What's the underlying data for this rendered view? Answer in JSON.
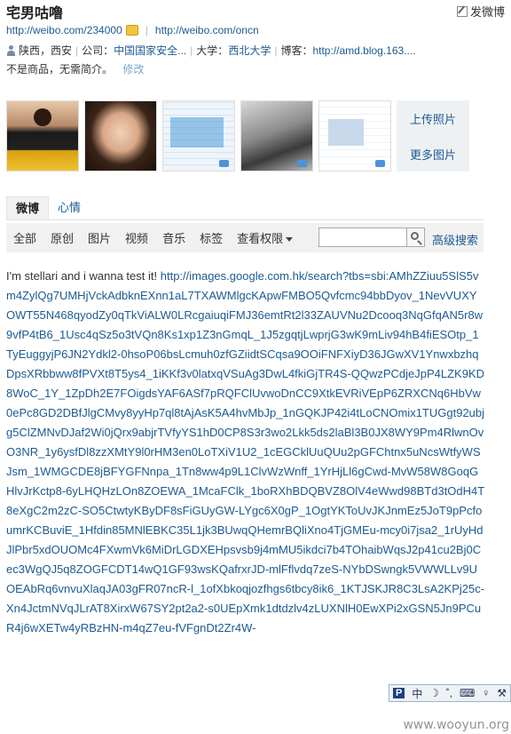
{
  "profile": {
    "name": "宅男咕噜",
    "post_label": "发微博",
    "url1": "http://weibo.com/234000",
    "url2": "http://weibo.com/oncn",
    "location": "陕西，西安",
    "company_label": "公司：",
    "company": "中国国家安全...",
    "university_label": "大学：",
    "university": "西北大学",
    "blog_label": "博客：",
    "blog": "http://amd.blog.163....",
    "bio": "不是商品，无需简介。",
    "edit_label": "修改"
  },
  "photos": {
    "upload_label": "上传照片",
    "more_label": "更多图片",
    "thumbnails": [
      "photo-woman-black-dress",
      "photo-woman-smiling",
      "photo-chat-screenshot",
      "photo-car",
      "photo-document-screenshot"
    ]
  },
  "tabs": [
    {
      "label": "微博",
      "active": true
    },
    {
      "label": "心情",
      "active": false
    }
  ],
  "filters": {
    "items": [
      "全部",
      "原创",
      "图片",
      "视频",
      "音乐",
      "标签"
    ],
    "permission_label": "查看权限",
    "search_placeholder": "",
    "advanced_search_label": "高级搜索"
  },
  "post": {
    "text": "I'm stellari and i wanna test it! ",
    "link": "http://images.google.com.hk/search?tbs=sbi:AMhZZiuu5SlS5vm4ZylQg7UMHjVckAdbknEXnn1aL7TXAWMlgcKApwFMBO5Qvfcmc94bbDyov_1NevVUXYOWT55N468qyodZy0qTkViALW0LRcgaiuqiFMJ36emtRt2l33ZAUVNu2Dcooq3NqGfqAN5r8w9vfP4tB6_1Usc4qSz5o3tVQn8Ks1xp1Z3nGmqL_1J5zgqtjLwprjG3wK9mLiv94hB4fiESOtp_1TyEuggyjP6JN2Ydkl2-0hsoP06bsLcmuh0zfGZiidtSCqsa9OOiFNFXiyD36JGwXV1YnwxbzhqDpsXRbbww8fPVXt8T5ys4_1iKKf3v0latxqVSuAg3DwL4fkiGjTR4S-QQwzPCdjeJpP4LZK9KD8WoC_1Y_1ZpDh2E7FOigdsYAF6ASf7pRQFClUvwoDnCC9XtkEVRiVEpP6ZRXCNq6HbVw0ePc8GD2DBfJlgCMvy8yyHp7ql8tAjAsK5A4hvMbJp_1nGQKJP42i4tLoCNOmix1TUGgt92ubjg5ClZMNvDJaf2Wi0jQrx9abjrTVfyYS1hD0CP8S3r3wo2Lkk5ds2laBl3B0JX8WY9Pm4RlwnOvO3NR_1y6ysfDl8zzXMtY9l0rHM3en0LoTXiV1U2_1cEGCklUuQUu2pGFChtnx5uNcsWtfyWSJsm_1WMGCDE8jBFYGFNnpa_1Tn8ww4p9L1ClvWzWnff_1YrHjLl6gCwd-MvW58W8GoqGHlvJrKctp8-6yLHQHzLOn8ZOEWA_1McaFClk_1boRXhBDQBVZ8OlV4eWwd98BTd3tOdH4T8eXgC2m2zC-SO5CtwtyKByDF8sFiGUyGW-LYgc6X0gP_1OgtYKToUvJKJnmEz5JoT9pPcfoumrKCBuviE_1Hfdin85MNlEBKC35L1jk3BUwqQHemrBQliXno4TjGMEu-mcy0i7jsa2_1rUyHdJlPbr5xdOUOMc4FXwmVk6MiDrLGDXEHpsvsb9j4mMU5ikdci7b4TOhaibWqsJ2p41cu2Bj0Cec3WgQJ5q8ZOGFCDT14wQ1GF93wsKQafrxrJD-mlFflvdq7zeS-NYbDSwngk5VWWLLv9UOEAbRq6vnvuXlaqJA03gFR07ncR-l_1ofXbkoqjozfhgs6tbcy8ik6_1KTJSKJR8C3LsA2KPj25c-Xn4JctmNVqJLrAT8XirxW67SY2pt2a2-s0UEpXmk1dtdzlv4zLUXNlH0EwXPi2xGSN5Jn9PCuR4j6wXETw4yRBzHN-m4qZ7eu-fVFgnDt2Zr4W-"
  },
  "ime_bar": {
    "logo": "P",
    "items": [
      "中",
      "☽",
      "˚,",
      "⌨",
      "♀",
      "⚒"
    ]
  },
  "watermark": "www.wooyun.org"
}
